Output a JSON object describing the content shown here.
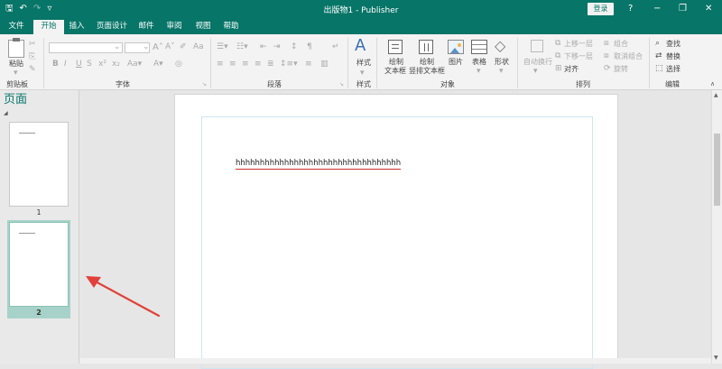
{
  "window": {
    "title": "出版物1 - Publisher",
    "login_label": "登录",
    "help_glyph": "?",
    "minimize_glyph": "−",
    "restore_glyph": "❐",
    "close_glyph": "✕"
  },
  "qat": {
    "save": "🖫",
    "undo": "↶",
    "redo": "↷",
    "customize": "▿"
  },
  "tabs": [
    {
      "label": "文件"
    },
    {
      "label": "开始"
    },
    {
      "label": "插入"
    },
    {
      "label": "页面设计"
    },
    {
      "label": "邮件"
    },
    {
      "label": "审阅"
    },
    {
      "label": "视图"
    },
    {
      "label": "帮助"
    }
  ],
  "ribbon": {
    "clipboard": {
      "paste_label": "粘贴",
      "group_label": "剪贴板"
    },
    "font": {
      "group_label": "字体"
    },
    "paragraph": {
      "group_label": "段落"
    },
    "styles": {
      "style_label": "样式",
      "group_label": "样式"
    },
    "objects": {
      "group_label": "对象",
      "draw_textbox_1": "绘制",
      "draw_textbox_2": "文本框",
      "draw_vtextbox_1": "绘制",
      "draw_vtextbox_2": "竖排文本框",
      "picture": "图片",
      "table": "表格",
      "shapes": "形状"
    },
    "arrange": {
      "group_label": "排列",
      "wrap_1": "自动换行",
      "bring_forward": "上移一层",
      "send_backward": "下移一层",
      "align": "对齐",
      "group": "组合",
      "ungroup": "取消组合",
      "rotate": "旋转"
    },
    "editing": {
      "group_label": "编辑",
      "find": "查找",
      "replace": "替换",
      "select": "选择"
    }
  },
  "pages_pane": {
    "title": "页面",
    "pages": [
      {
        "num": "1"
      },
      {
        "num": "2"
      }
    ]
  },
  "document": {
    "text": "hhhhhhhhhhhhhhhhhhhhhhhhhhhhhhhhhh"
  },
  "colors": {
    "accent": "#077568",
    "selected_thumb": "#a7d2c9",
    "arrow": "#e0413a"
  }
}
